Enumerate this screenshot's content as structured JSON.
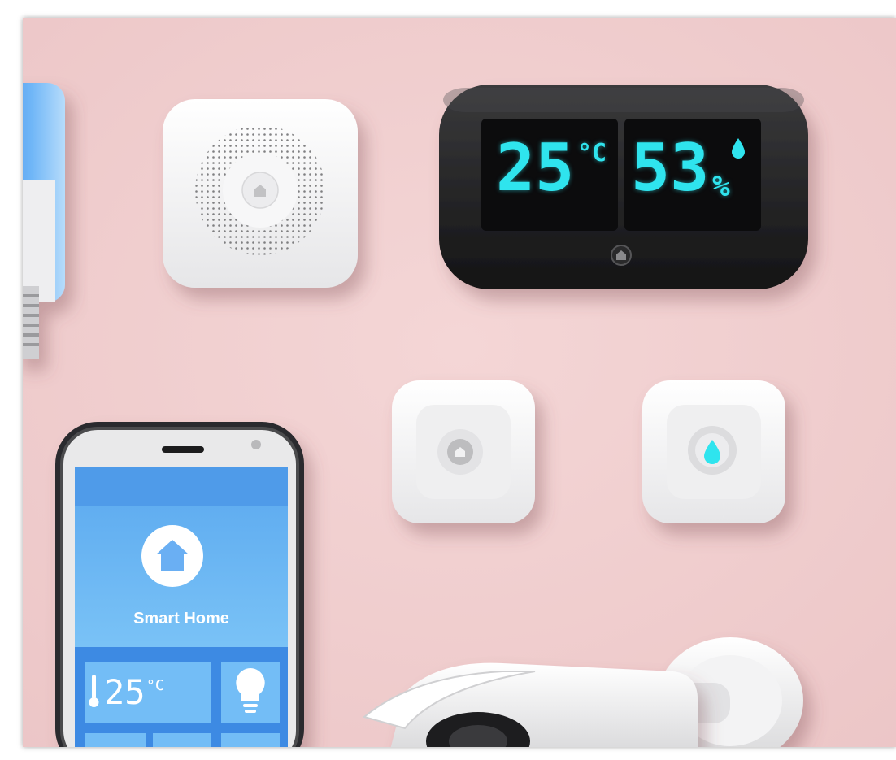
{
  "scene": {
    "background_color": "#f1cfd0",
    "accent_color": "#2fe4ee"
  },
  "thermo_display": {
    "temperature_value": "25",
    "temperature_unit": "°C",
    "humidity_value": "53",
    "humidity_unit": "%"
  },
  "phone": {
    "app_title": "Smart Home",
    "tile_temperature_value": "25",
    "tile_temperature_unit": "°C",
    "icons": [
      "home-icon",
      "thermometer-icon",
      "bulb-icon"
    ]
  },
  "devices": [
    "smart-bulb",
    "speaker-hub",
    "thermo-hygrometer-display",
    "motion-sensor",
    "water-leak-sensor",
    "smartphone",
    "security-camera"
  ]
}
